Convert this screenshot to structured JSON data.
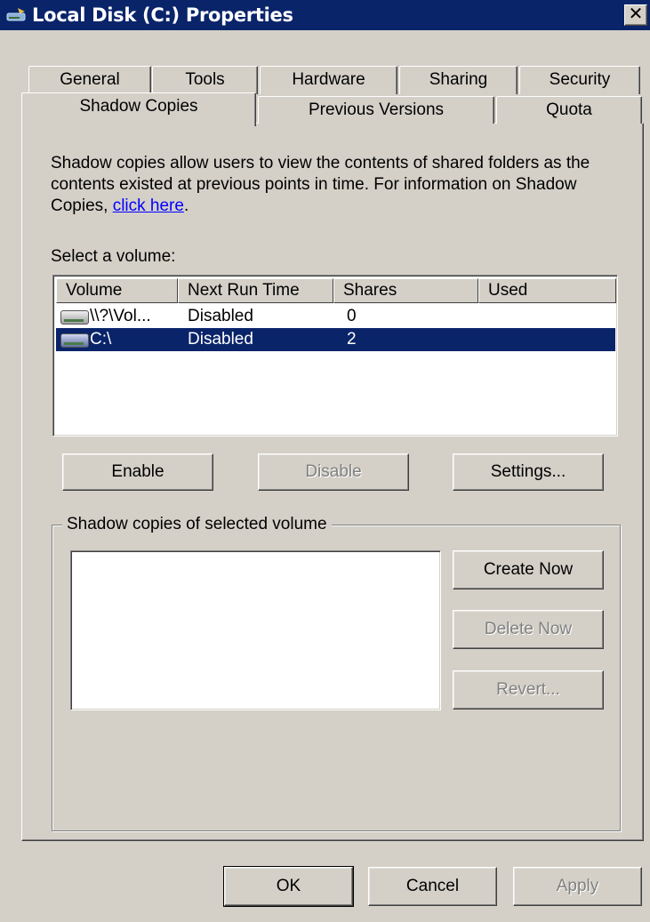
{
  "window": {
    "title": "Local Disk (C:) Properties",
    "close_label": "✕"
  },
  "tabs_row1": [
    "General",
    "Tools",
    "Hardware",
    "Sharing",
    "Security"
  ],
  "tabs_row2": [
    "Shadow Copies",
    "Previous Versions",
    "Quota"
  ],
  "active_tab": "Shadow Copies",
  "description": {
    "text": "Shadow copies allow users to view the contents of shared folders as the contents existed at previous points in time. For information on Shadow Copies, ",
    "link": "click here",
    "suffix": "."
  },
  "select_volume_label": "Select a volume:",
  "volume_table": {
    "columns": [
      "Volume",
      "Next Run Time",
      "Shares",
      "Used"
    ],
    "rows": [
      {
        "volume": "\\\\?\\Vol...",
        "next_run": "Disabled",
        "shares": "0",
        "used": "",
        "icon": "drive-icon",
        "selected": false
      },
      {
        "volume": "C:\\",
        "next_run": "Disabled",
        "shares": "2",
        "used": "",
        "icon": "drive-icon",
        "selected": true
      }
    ]
  },
  "buttons": {
    "enable": "Enable",
    "disable": "Disable",
    "settings": "Settings...",
    "create_now": "Create Now",
    "delete_now": "Delete Now",
    "revert": "Revert...",
    "ok": "OK",
    "cancel": "Cancel",
    "apply": "Apply"
  },
  "group_label": "Shadow copies of selected volume",
  "colors": {
    "titlebar": "#0a246a",
    "face": "#d4d0c8",
    "selection": "#0a246a",
    "link": "#0000ff"
  }
}
